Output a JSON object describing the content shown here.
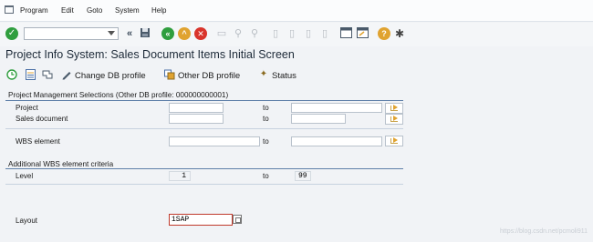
{
  "menubar": {
    "icon": "sap-menu-icon",
    "items": [
      "Program",
      "Edit",
      "Goto",
      "System",
      "Help"
    ]
  },
  "toolbar": {
    "ok_icon": "checkmark-icon",
    "command_field": {
      "value": "",
      "placeholder": ""
    },
    "icons": [
      "double-left-icon",
      "save-icon",
      "back-icon",
      "exit-icon",
      "cancel-icon",
      "print-icon",
      "find-icon",
      "find-next-icon",
      "first-page-icon",
      "previous-page-icon",
      "next-page-icon",
      "last-page-icon",
      "create-session-icon",
      "shortcut-icon",
      "help-icon",
      "customize-icon"
    ],
    "colors": {
      "ok": "#2f9e3e",
      "back": "#2f9e3e",
      "exit": "#e0a330",
      "cancel": "#d9342b",
      "help": "#e0a330"
    }
  },
  "title": "Project Info System: Sales Document Items Initial Screen",
  "app_toolbar": {
    "execute_icon": "execute-icon",
    "list_icon": "list-icon",
    "filter_icon": "filter-icon",
    "change_db_profile": "Change DB profile",
    "other_db_profile": "Other DB profile",
    "status": "Status"
  },
  "group_pm": {
    "title": "Project Management Selections (Other DB profile: 000000000001)",
    "rows": [
      {
        "label": "Project",
        "from": "",
        "to_label": "to",
        "to": ""
      },
      {
        "label": "Sales document",
        "from": "",
        "to_label": "to",
        "to": ""
      },
      {
        "label": "WBS element",
        "from": "",
        "to_label": "to",
        "to": ""
      }
    ]
  },
  "group_wbs": {
    "title": "Additional WBS element criteria",
    "level_label": "Level",
    "level_from": "1",
    "to_label": "to",
    "level_to": "99"
  },
  "layout": {
    "label": "Layout",
    "value": "1SAP"
  },
  "watermark": "https://blog.csdn.net/pcmoli911"
}
